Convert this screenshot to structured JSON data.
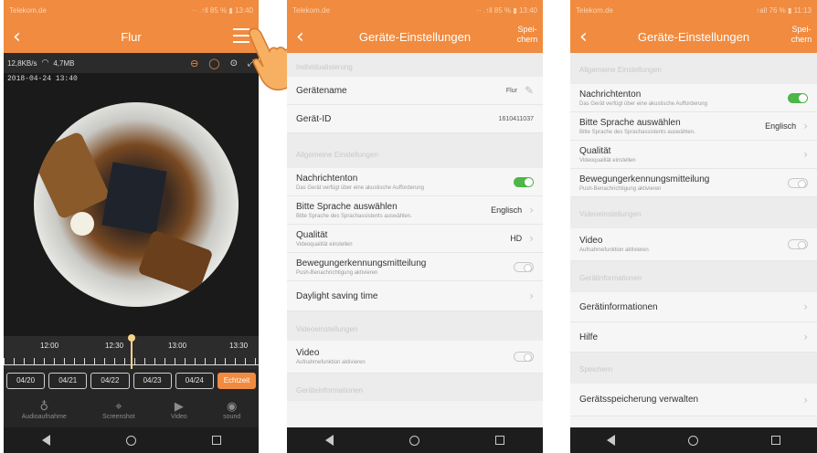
{
  "colors": {
    "accent": "#f08b3f",
    "toggle_on": "#4cb648"
  },
  "phone1": {
    "status": {
      "carrier": "Telekom.de",
      "right": "·· .↑ll 85 % ▮ 13:40"
    },
    "title": "Flur",
    "toolbar": {
      "speed": "12,8KB/s",
      "wifi_icon": "wifi-icon",
      "data": "4,7MB"
    },
    "timestamp": "2018-04-24 13:40",
    "timeline": {
      "ticks": [
        "12:00",
        "12:30",
        "13:00",
        "13:30"
      ]
    },
    "dates": [
      "04/20",
      "04/21",
      "04/22",
      "04/23",
      "04/24"
    ],
    "live_label": "Echtzeit",
    "bottom": [
      {
        "icon": "microphone-icon",
        "glyph": "♁",
        "label": "Audioaufnahme"
      },
      {
        "icon": "crop-icon",
        "glyph": "⌖",
        "label": "Screenshot"
      },
      {
        "icon": "video-icon",
        "glyph": "▶",
        "label": "Video"
      },
      {
        "icon": "speaker-icon",
        "glyph": "◉",
        "label": "sound"
      }
    ]
  },
  "phone2": {
    "status": {
      "carrier": "Telekom.de",
      "right": "·· .↑ll 85 % ▮ 13:40"
    },
    "title": "Geräte-Einstellungen",
    "save": "Spei-\nchern",
    "sections": {
      "ind": "Individualisierung",
      "allg": "Allgemeine Einstellungen",
      "video": "Videoeinstellungen",
      "info": "Geräteinformationen"
    },
    "rows": {
      "name": {
        "label": "Gerätename",
        "value": "Flur"
      },
      "id": {
        "label": "Gerät-ID",
        "value": "1610411037"
      },
      "ton": {
        "label": "Nachrichtenton",
        "sub": "Das Gerät verfügt über eine akustische Aufforderung"
      },
      "lang": {
        "label": "Bitte Sprache auswählen",
        "sub": "Bitte Sprache des Sprachassistents auswählen.",
        "value": "Englisch"
      },
      "qual": {
        "label": "Qualität",
        "sub": "Videoqualität einstellen",
        "value": "HD"
      },
      "motion": {
        "label": "Bewegungerkennungsmitteilung",
        "sub": "Push-Benachrichtigung aktivieren"
      },
      "dst": {
        "label": "Daylight saving time"
      },
      "video": {
        "label": "Video",
        "sub": "Aufnahmefunktion aktivieren"
      }
    }
  },
  "phone3": {
    "status": {
      "carrier": "Telekom.de",
      "right": "↑all 76 % ▮ 11:13"
    },
    "title": "Geräte-Einstellungen",
    "save": "Spei-\nchern",
    "sections": {
      "allg": "Allgemeine Einstellungen",
      "video": "Videoeinstellungen",
      "info": "Gerätinformationen",
      "store": "Speichern"
    },
    "rows": {
      "ton": {
        "label": "Nachrichtenton",
        "sub": "Das Gerät verfügt über eine akustische Aufforderung"
      },
      "lang": {
        "label": "Bitte Sprache auswählen",
        "sub": "Bitte Sprache des Sprachassistents auswählen.",
        "value": "Englisch"
      },
      "qual": {
        "label": "Qualität",
        "sub": "Videoqualität einstellen"
      },
      "motion": {
        "label": "Bewegungerkennungsmitteilung",
        "sub": "Push-Benachrichtigung aktivieren"
      },
      "video": {
        "label": "Video",
        "sub": "Aufnahmefunktion aktivieren"
      },
      "info": {
        "label": "Gerätinformationen"
      },
      "help": {
        "label": "Hilfe"
      },
      "storage": {
        "label": "Gerätsspeicherung verwalten"
      }
    }
  }
}
